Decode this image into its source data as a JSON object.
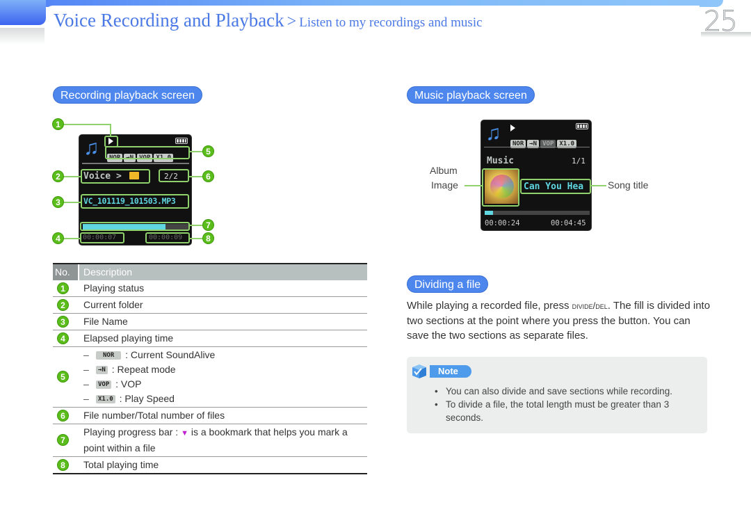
{
  "header": {
    "title": "Voice Recording and Playback",
    "separator": ">",
    "subtitle": "Listen to my recordings and music",
    "page_number": "25"
  },
  "recording_screen": {
    "heading": "Recording playback screen",
    "status_chips": [
      "NOR",
      "→N",
      "VOP",
      "X1.0"
    ],
    "folder": "Voice >",
    "file_count": "2/2",
    "file_name": "VC_101119_101503.MP3",
    "elapsed": "00:00:07",
    "total": "00:00:09",
    "progress_fraction": 0.78,
    "callouts": [
      "1",
      "2",
      "3",
      "4",
      "5",
      "6",
      "7",
      "8"
    ]
  },
  "music_screen": {
    "heading": "Music playback screen",
    "status_chips": [
      "NOR",
      "→N",
      "VOP",
      "X1.0"
    ],
    "folder": "Music",
    "file_count": "1/1",
    "song_title": "Can You Hea",
    "elapsed": "00:00:24",
    "total": "00:04:45",
    "progress_fraction": 0.08,
    "label_album_line1": "Album",
    "label_album_line2": "Image",
    "label_song": "Song title"
  },
  "table": {
    "col_no": "No.",
    "col_desc": "Description",
    "rows": [
      {
        "num": "1",
        "desc": "Playing status"
      },
      {
        "num": "2",
        "desc": "Current folder"
      },
      {
        "num": "3",
        "desc": "File Name"
      },
      {
        "num": "4",
        "desc": "Elapsed playing time"
      },
      {
        "num": "5",
        "items": [
          {
            "chip": "NOR",
            "text": ": Current SoundAlive"
          },
          {
            "chip": "→N",
            "text": ": Repeat mode"
          },
          {
            "chip": "VOP",
            "text": ": VOP"
          },
          {
            "chip": "X1.0",
            "text": ": Play Speed"
          }
        ]
      },
      {
        "num": "6",
        "desc": "File number/Total number of files"
      },
      {
        "num": "7",
        "desc_before": "Playing progress bar :",
        "desc_after": "is a bookmark that helps you mark a point within a file"
      },
      {
        "num": "8",
        "desc": "Total playing time"
      }
    ],
    "dash": "–"
  },
  "dividing": {
    "heading": "Dividing a file",
    "text_before": "While playing a recorded file, press ",
    "button_name": "DIVIDE/DEL",
    "text_after": ". The fill is divided into two sections at the point where you press the button. You can save the two sections as separate files."
  },
  "note": {
    "label": "Note",
    "items": [
      "You can also divide and save sections while recording.",
      "To divide a file, the total length must be greater than 3 seconds."
    ]
  },
  "colors": {
    "accent_blue": "#4d86ec",
    "callout_green": "#5bbd1b",
    "lcd_cyan": "#5fd6e0",
    "bookmark_magenta": "#c020d0"
  }
}
